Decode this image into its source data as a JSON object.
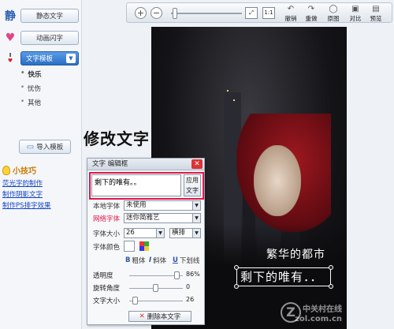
{
  "sidebar": {
    "static_text": "静态文字",
    "animated_text": "动画闪字",
    "text_template": "文字模板",
    "template_items": [
      "快乐",
      "忧伤",
      "其他"
    ],
    "import_template": "导入模板",
    "tips_title": "小技巧",
    "tips": [
      "荧光字的制作",
      "制作阴影文字",
      "制作PS排字效果"
    ]
  },
  "toolbar": {
    "undo": "撤销",
    "redo": "重做",
    "original": "原图",
    "compare": "对比",
    "preview": "预览"
  },
  "annotation": "修改文字",
  "editor": {
    "title": "文字 编辑框",
    "text_value": "剩下的唯有。。",
    "apply_label": "应用文字",
    "local_font_label": "本地字体",
    "local_font_value": "未使用",
    "web_font_label": "网络字体",
    "web_font_value": "迷你简雅艺",
    "size_label": "字体大小",
    "size_value": "26",
    "orientation_value": "横排",
    "color_label": "字体颜色",
    "bold_label": "粗体",
    "italic_label": "斜体",
    "underline_label": "下划线",
    "opacity_label": "透明度",
    "opacity_value": "86%",
    "rotation_label": "旋转角度",
    "rotation_value": "0",
    "text_size_label": "文字大小",
    "text_size_value": "26",
    "delete_label": "删除本文字"
  },
  "canvas": {
    "line1": "繁华的都市",
    "line2": "剩下的唯有．．",
    "watermark_cn": "中关村在线",
    "watermark_en": "zol.com.cn"
  },
  "colors": {
    "accent": "#2a6fc4",
    "highlight_frame": "#e0184a",
    "link": "#1447c7"
  }
}
